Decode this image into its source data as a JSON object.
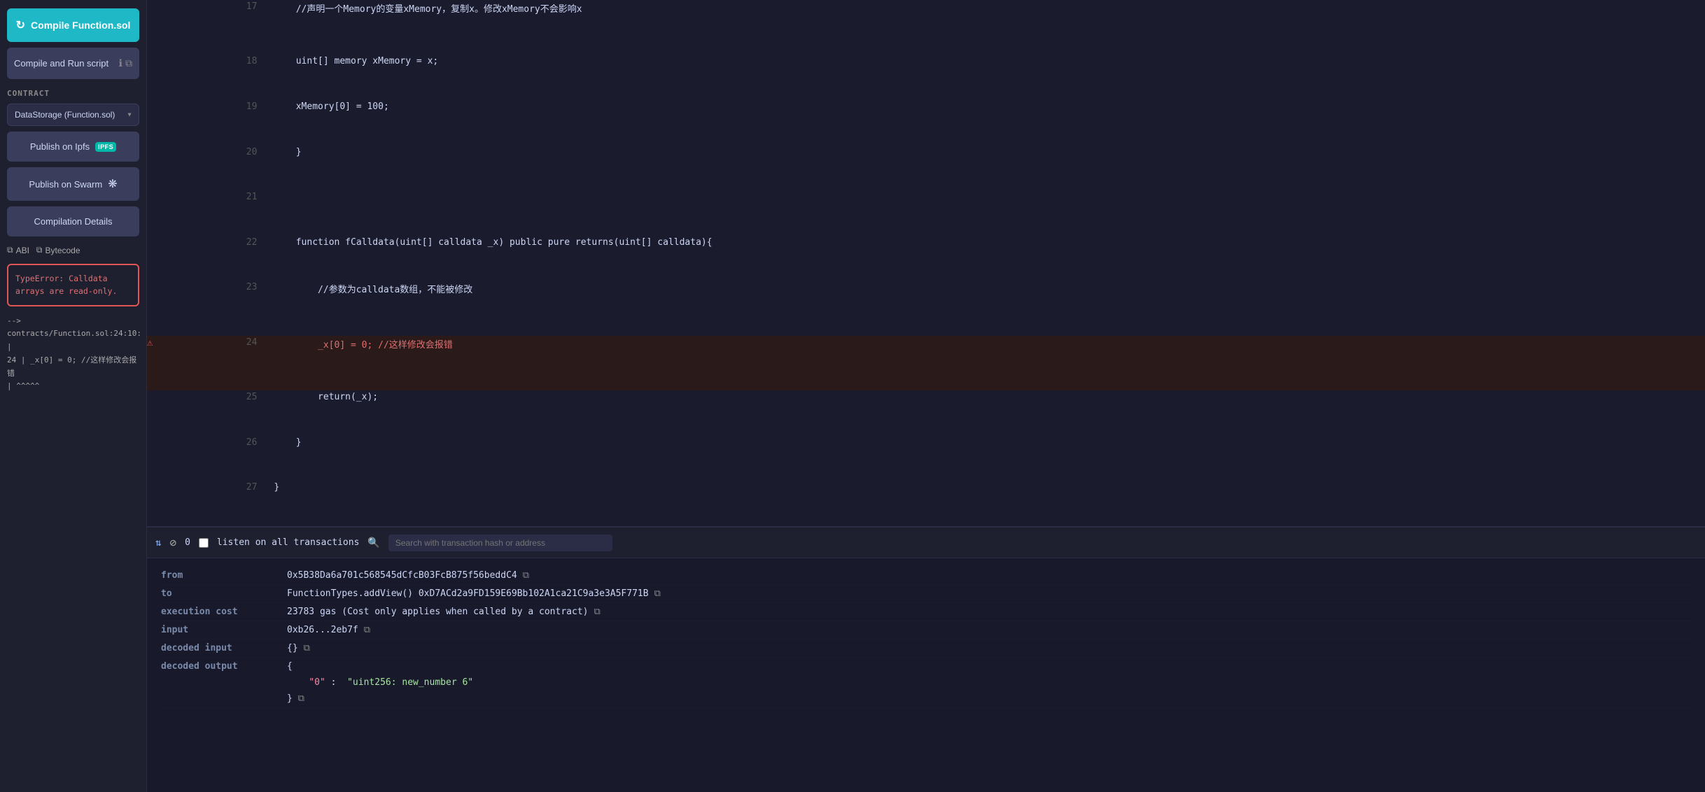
{
  "left": {
    "compile_btn_label": "Compile Function.sol",
    "compile_run_label": "Compile and Run script",
    "contract_label": "CONTRACT",
    "contract_value": "DataStorage (Function.sol)",
    "publish_ipfs_label": "Publish on Ipfs",
    "publish_swarm_label": "Publish on Swarm",
    "compilation_details_label": "Compilation Details",
    "abi_label": "ABI",
    "bytecode_label": "Bytecode",
    "error_title": "TypeError: Calldata arrays are\nread-only.",
    "error_arrow": "-->",
    "error_location": "contracts/Function.sol:24:10:",
    "error_pipe": "|",
    "error_line": "24 | _x[0] = 0; //这样修改会报错",
    "error_caret": "| ^^^^^"
  },
  "toolbar": {
    "ban_icon": "⊘",
    "count": "0",
    "listen_label": "listen on all transactions",
    "search_placeholder": "Search with transaction hash or address"
  },
  "transaction": {
    "from_label": "from",
    "from_value": "0x5B38Da6a701c568545dCfcB03FcB875f56beddC4",
    "to_label": "to",
    "to_value": "FunctionTypes.addView() 0xD7ACd2a9FD159E69Bb102A1ca21C9a3e3A5F771B",
    "exec_cost_label": "execution cost",
    "exec_cost_value": "23783 gas (Cost only applies when called by a contract)",
    "input_label": "input",
    "input_value": "0xb26...2eb7f",
    "decoded_input_label": "decoded input",
    "decoded_input_value": "{}",
    "decoded_output_label": "decoded output",
    "decoded_output_open": "{",
    "decoded_output_key": "\"0\"",
    "decoded_output_colon": ":",
    "decoded_output_val": "\"uint256: new_number 6\"",
    "decoded_output_close": "}"
  },
  "code": {
    "lines": [
      {
        "num": 17,
        "content": "    //声明一个Memory的变量xMemory，复制x。修改xMemory不会影响x",
        "error": false
      },
      {
        "num": 18,
        "content": "    uint[] memory xMemory = x;",
        "error": false
      },
      {
        "num": 19,
        "content": "    xMemory[0] = 100;",
        "error": false
      },
      {
        "num": 20,
        "content": "    }",
        "error": false
      },
      {
        "num": 21,
        "content": "",
        "error": false
      },
      {
        "num": 22,
        "content": "    function fCalldata(uint[] calldata _x) public pure returns(uint[] calldata){",
        "error": false
      },
      {
        "num": 23,
        "content": "        //参数为calldata数组，不能被修改",
        "error": false
      },
      {
        "num": 24,
        "content": "        _x[0] = 0; //这样修改会报错",
        "error": true
      },
      {
        "num": 25,
        "content": "        return(_x);",
        "error": false
      },
      {
        "num": 26,
        "content": "    }",
        "error": false
      },
      {
        "num": 27,
        "content": "}",
        "error": false
      }
    ]
  }
}
